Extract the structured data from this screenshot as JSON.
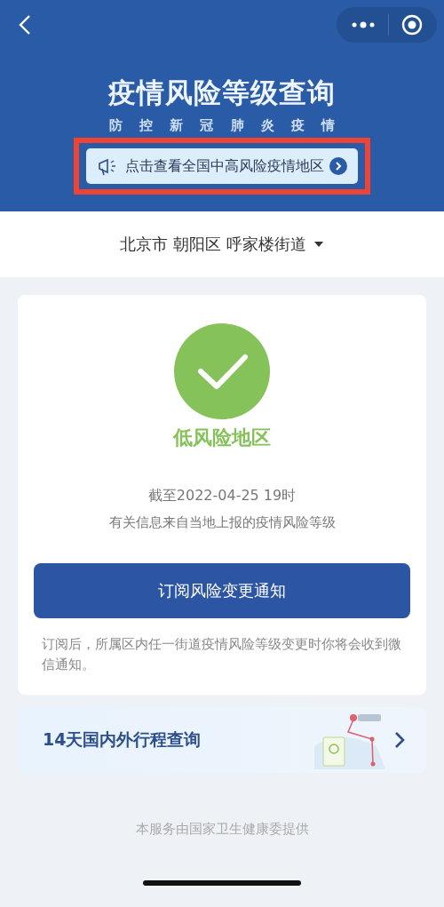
{
  "header": {
    "title": "疫情风险等级查询",
    "subtitle": "防 控 新 冠 肺 炎 疫 情",
    "notice": "点击查看全国中高风险疫情地区"
  },
  "location": {
    "text": "北京市 朝阳区 呼家楼街道"
  },
  "result": {
    "kind": "low",
    "level_text": "低风险地区",
    "as_of": "截至2022-04-25 19时",
    "source_note": "有关信息来自当地上报的疫情风险等级",
    "button": "订阅风险变更通知",
    "subscribe_note": "订阅后，所属区内任一街道疫情风险等级变更时你将会收到微信通知。"
  },
  "trip": {
    "label": "14天国内外行程查询"
  },
  "footer": "本服务由国家卫生健康委提供"
}
